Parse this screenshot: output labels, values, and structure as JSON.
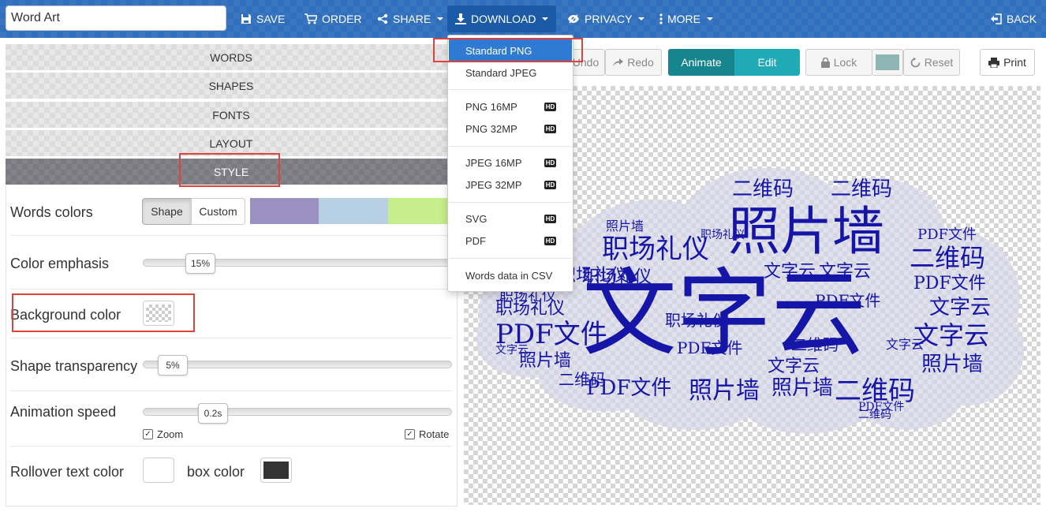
{
  "header": {
    "title_value": "Word Art",
    "buttons": {
      "save": "SAVE",
      "order": "ORDER",
      "share": "SHARE",
      "download": "DOWNLOAD",
      "privacy": "PRIVACY",
      "more": "MORE",
      "back": "BACK"
    }
  },
  "download_menu": {
    "items": [
      {
        "label": "Standard PNG",
        "highlighted": true
      },
      {
        "label": "Standard JPEG"
      },
      {
        "label": "PNG 16MP",
        "badge": "HD"
      },
      {
        "label": "PNG 32MP",
        "badge": "HD"
      },
      {
        "label": "JPEG 16MP",
        "badge": "HD"
      },
      {
        "label": "JPEG 32MP",
        "badge": "HD"
      },
      {
        "label": "SVG",
        "badge": "HD"
      },
      {
        "label": "PDF",
        "badge": "HD"
      },
      {
        "label": "Words data in CSV"
      }
    ]
  },
  "sections": {
    "words": "WORDS",
    "shapes": "SHAPES",
    "fonts": "FONTS",
    "layout": "LAYOUT",
    "style": "STYLE"
  },
  "style_panel": {
    "words_colors": {
      "label": "Words colors",
      "shape_btn": "Shape",
      "custom_btn": "Custom",
      "palette": [
        "#9a91c0",
        "#b8d0e4",
        "#c6ee8a"
      ]
    },
    "color_emphasis": {
      "label": "Color emphasis",
      "value": "15%",
      "percent": 15
    },
    "background_color": {
      "label": "Background color"
    },
    "shape_transparency": {
      "label": "Shape transparency",
      "value": "5%",
      "percent": 5
    },
    "animation_speed": {
      "label": "Animation speed",
      "value": "0.2s",
      "zoom": "Zoom",
      "rotate": "Rotate"
    },
    "rollover": {
      "label": "Rollover text color",
      "box_label": "box color",
      "text_color": "#ffffff",
      "box_color": "#333333"
    }
  },
  "toolbar": {
    "undo": "Undo",
    "redo": "Redo",
    "animate": "Animate",
    "edit": "Edit",
    "lock": "Lock",
    "reset": "Reset",
    "print": "Print",
    "lock_color": "#8fb5b5"
  },
  "word_cloud": {
    "color": "#1515a8",
    "words": [
      "文字云",
      "照片墙",
      "职场礼仪",
      "二维码",
      "PDF文件"
    ]
  },
  "colors": {
    "header_bg": "#2f6fbd",
    "animate_bg": "#16858e",
    "edit_bg": "#1faab5",
    "highlight": "#2f7bd3",
    "annotation": "#e2403b"
  }
}
